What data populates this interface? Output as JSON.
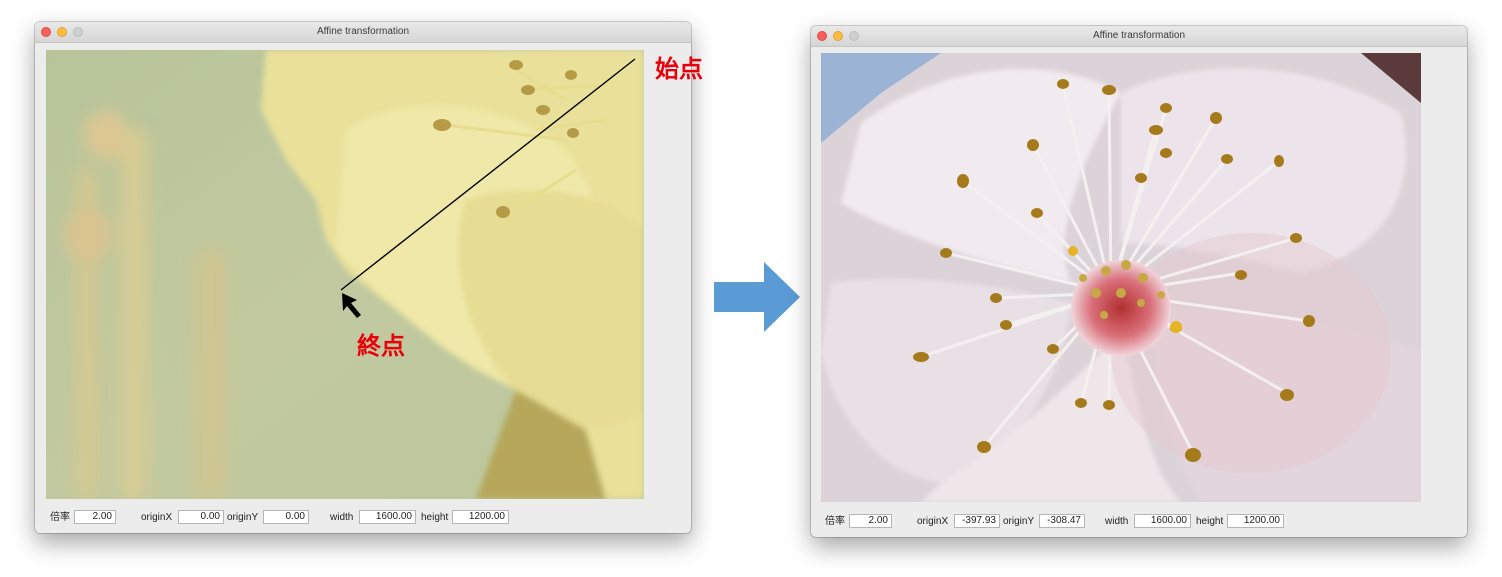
{
  "left_window": {
    "title": "Affine transformation",
    "controls": {
      "scale_label": "倍率",
      "scale_value": "2.00",
      "origin_x_label": "originX",
      "origin_x_value": "0.00",
      "origin_y_label": "originY",
      "origin_y_value": "0.00",
      "width_label": "width",
      "width_value": "1600.00",
      "height_label": "height",
      "height_value": "1200.00"
    }
  },
  "right_window": {
    "title": "Affine transformation",
    "controls": {
      "scale_label": "倍率",
      "scale_value": "2.00",
      "origin_x_label": "originX",
      "origin_x_value": "-397.93",
      "origin_y_label": "originY",
      "origin_y_value": "-308.47",
      "width_label": "width",
      "width_value": "1600.00",
      "height_label": "height",
      "height_value": "1200.00"
    }
  },
  "annotations": {
    "start_point": "始点",
    "end_point": "終点",
    "color": "#e8000b"
  },
  "icons": {
    "arrow": "right-arrow-icon",
    "pointer": "cursor-arrow-icon"
  },
  "colors": {
    "arrow": "#5b9bd5",
    "window_bg": "#ececec"
  }
}
